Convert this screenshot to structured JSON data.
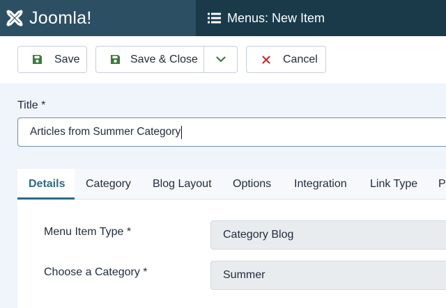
{
  "header": {
    "brand_name": "Joomla!",
    "page_title": "Menus: New Item"
  },
  "toolbar": {
    "save_label": "Save",
    "save_close_label": "Save & Close",
    "cancel_label": "Cancel"
  },
  "form": {
    "title_label": "Title *",
    "title_value": "Articles from Summer Category"
  },
  "tabs": [
    {
      "label": "Details",
      "active": true
    },
    {
      "label": "Category"
    },
    {
      "label": "Blog Layout"
    },
    {
      "label": "Options"
    },
    {
      "label": "Integration"
    },
    {
      "label": "Link Type"
    },
    {
      "label": "P"
    }
  ],
  "details": {
    "menu_item_type_label": "Menu Item Type *",
    "menu_item_type_value": "Category Blog",
    "category_label": "Choose a Category *",
    "category_value": "Summer"
  },
  "colors": {
    "brand_bg": "#2c4f63",
    "title_bar_bg": "#1a3a4a",
    "save_icon": "#3a7a3a",
    "cancel_icon": "#c52b2b",
    "tab_active": "#2a6b84"
  }
}
